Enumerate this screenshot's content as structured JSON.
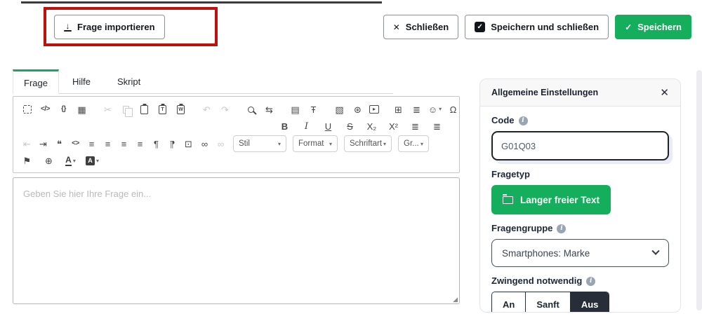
{
  "header": {
    "import_label": "Frage importieren",
    "close_label": "Schließen",
    "save_close_label": "Speichern und schließen",
    "save_label": "Speichern"
  },
  "tabs": {
    "frage": "Frage",
    "hilfe": "Hilfe",
    "skript": "Skript"
  },
  "editor": {
    "placeholder": "Geben Sie hier Ihre Frage ein...",
    "toolbar": {
      "rows": [
        [
          {
            "n": "maximize-icon",
            "t": "fs"
          },
          {
            "n": "source-icon",
            "g": "</>",
            "cls": "small"
          },
          {
            "n": "templates-icon",
            "g": "{}",
            "cls": "small"
          },
          {
            "n": "show-blocks-icon",
            "g": "▦"
          },
          {
            "t": "sep"
          },
          {
            "n": "cut-icon",
            "g": "✂",
            "d": true
          },
          {
            "n": "copy-icon",
            "t": "copy",
            "d": true
          },
          {
            "n": "paste-icon",
            "t": "clip",
            "g": ""
          },
          {
            "n": "paste-text-icon",
            "t": "clip",
            "g": "T"
          },
          {
            "n": "paste-word-icon",
            "t": "clip",
            "g": "W"
          },
          {
            "t": "sep"
          },
          {
            "n": "undo-icon",
            "g": "↶",
            "d": true
          },
          {
            "n": "redo-icon",
            "g": "↷",
            "d": true
          },
          {
            "t": "sep"
          },
          {
            "n": "find-icon",
            "t": "mag"
          },
          {
            "n": "replace-icon",
            "g": "⇆"
          },
          {
            "t": "sep"
          },
          {
            "n": "document-icon",
            "g": "▤"
          },
          {
            "n": "remove-format-icon",
            "g": "Ŧ"
          },
          {
            "t": "sep"
          },
          {
            "n": "image-icon",
            "g": "▧"
          },
          {
            "n": "flash-icon",
            "g": "⊛"
          },
          {
            "n": "media-embed-icon",
            "g": "▸",
            "cls": "bx"
          },
          {
            "t": "sep"
          },
          {
            "n": "table-icon",
            "g": "⊞"
          },
          {
            "n": "horizontal-rule-icon",
            "g": "≣"
          },
          {
            "n": "smiley-icon",
            "g": "☺",
            "caret": true
          },
          {
            "n": "special-character-icon",
            "g": "Ω"
          }
        ],
        [
          {
            "n": "bold-icon",
            "g": "B",
            "cls": "bold"
          },
          {
            "n": "italic-icon",
            "g": "I",
            "cls": "italic"
          },
          {
            "n": "underline-icon",
            "g": "U",
            "cls": "underline"
          },
          {
            "n": "strikethrough-icon",
            "g": "S",
            "cls": "strike"
          },
          {
            "n": "subscript-icon",
            "g": "X₂"
          },
          {
            "n": "superscript-icon",
            "g": "X²"
          },
          {
            "n": "numbered-list-icon",
            "g": "≣"
          },
          {
            "n": "bulleted-list-icon",
            "g": "≣"
          }
        ],
        [
          {
            "n": "outdent-icon",
            "g": "⇤",
            "d": true
          },
          {
            "n": "indent-icon",
            "g": "⇥"
          },
          {
            "n": "blockquote-icon",
            "g": "❝"
          },
          {
            "n": "div-container-icon",
            "g": "<>",
            "cls": "small"
          },
          {
            "n": "align-left-icon",
            "g": "≡"
          },
          {
            "n": "align-center-icon",
            "g": "≡"
          },
          {
            "n": "align-right-icon",
            "g": "≡"
          },
          {
            "n": "align-justify-icon",
            "g": "≡"
          },
          {
            "n": "bidi-ltr-icon",
            "g": "¶"
          },
          {
            "n": "bidi-rtl-icon",
            "g": "¶",
            "cls": "flip"
          },
          {
            "n": "iframe-icon",
            "g": "⊡"
          },
          {
            "n": "link-icon",
            "g": "∞"
          },
          {
            "n": "unlink-icon",
            "g": "∞",
            "d": true
          }
        ],
        [
          {
            "n": "flag-icon",
            "g": "⚑"
          },
          {
            "n": "language-icon",
            "g": "⊕"
          },
          {
            "n": "text-color-icon",
            "t": "acolor",
            "caret": true
          },
          {
            "n": "background-color-icon",
            "t": "abg",
            "caret": true
          }
        ]
      ],
      "dropdowns": [
        {
          "name": "style-dropdown",
          "label": "Stil"
        },
        {
          "name": "format-dropdown",
          "label": "Format"
        },
        {
          "name": "font-dropdown",
          "label": "Schriftart"
        },
        {
          "name": "size-dropdown",
          "label": "Gr..."
        }
      ]
    }
  },
  "panel": {
    "title": "Allgemeine Einstellungen",
    "code_label": "Code",
    "code_value": "G01Q03",
    "question_type_label": "Fragetyp",
    "question_type_value": "Langer freier Text",
    "question_group_label": "Fragengruppe",
    "question_group_value": "Smartphones: Marke",
    "mandatory_label": "Zwingend notwendig",
    "mandatory_options": [
      "An",
      "Sanft",
      "Aus"
    ],
    "mandatory_selected": "Aus"
  },
  "colors": {
    "accent_green": "#14ae5c",
    "highlight_red": "#bf1010",
    "dark_navy": "#272d39"
  }
}
